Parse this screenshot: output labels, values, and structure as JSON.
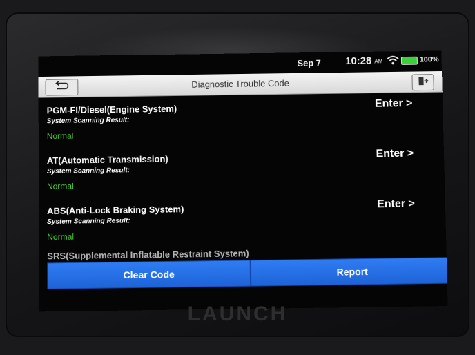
{
  "status_bar": {
    "date": "Sep 7",
    "time": "10:28",
    "ampm": "AM",
    "battery": "100%",
    "icons": [
      "wifi-icon",
      "battery-icon"
    ]
  },
  "header": {
    "title": "Diagnostic Trouble Code",
    "back_icon": "back-arrow-icon",
    "exit_icon": "exit-door-icon"
  },
  "systems": [
    {
      "name": "PGM-FI/Diesel(Engine System)",
      "scan_label": "System Scanning Result:",
      "result": "Normal",
      "action": "Enter >"
    },
    {
      "name": "AT(Automatic Transmission)",
      "scan_label": "System Scanning Result:",
      "result": "Normal",
      "action": "Enter >"
    },
    {
      "name": "ABS(Anti-Lock Braking System)",
      "scan_label": "System Scanning Result:",
      "result": "Normal",
      "action": "Enter >"
    }
  ],
  "partial_item": "SRS(Supplemental Inflatable Restraint System)",
  "footer": {
    "clear_label": "Clear Code",
    "report_label": "Report"
  },
  "device_brand": "LAUNCH",
  "colors": {
    "accent_blue": "#2f7cf2",
    "normal_green": "#4cd137",
    "battery_green": "#3bd13b"
  }
}
